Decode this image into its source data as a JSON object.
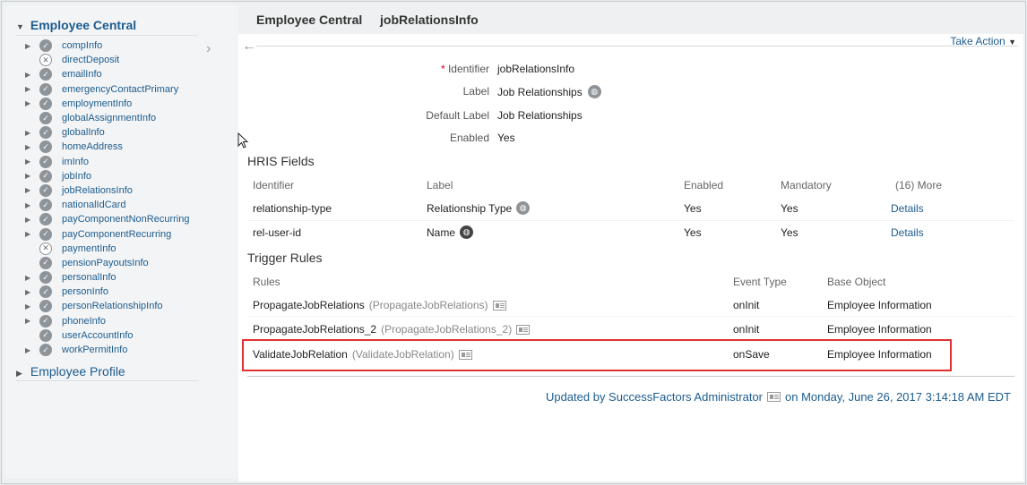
{
  "sidebar": {
    "section_title": "Employee Central",
    "section2_title": "Employee Profile",
    "items": [
      {
        "label": "compInfo",
        "status": "ok",
        "expand": true
      },
      {
        "label": "directDeposit",
        "status": "disabled",
        "expand": false
      },
      {
        "label": "emailInfo",
        "status": "ok",
        "expand": true
      },
      {
        "label": "emergencyContactPrimary",
        "status": "ok",
        "expand": true
      },
      {
        "label": "employmentInfo",
        "status": "ok",
        "expand": true
      },
      {
        "label": "globalAssignmentInfo",
        "status": "ok",
        "expand": false
      },
      {
        "label": "globalInfo",
        "status": "ok",
        "expand": true
      },
      {
        "label": "homeAddress",
        "status": "ok",
        "expand": true
      },
      {
        "label": "imInfo",
        "status": "ok",
        "expand": true
      },
      {
        "label": "jobInfo",
        "status": "ok",
        "expand": true
      },
      {
        "label": "jobRelationsInfo",
        "status": "ok",
        "expand": true
      },
      {
        "label": "nationalIdCard",
        "status": "ok",
        "expand": true
      },
      {
        "label": "payComponentNonRecurring",
        "status": "ok",
        "expand": true
      },
      {
        "label": "payComponentRecurring",
        "status": "ok",
        "expand": true
      },
      {
        "label": "paymentInfo",
        "status": "disabled",
        "expand": false
      },
      {
        "label": "pensionPayoutsInfo",
        "status": "ok",
        "expand": false
      },
      {
        "label": "personalInfo",
        "status": "ok",
        "expand": true
      },
      {
        "label": "personInfo",
        "status": "ok",
        "expand": true
      },
      {
        "label": "personRelationshipInfo",
        "status": "ok",
        "expand": true
      },
      {
        "label": "phoneInfo",
        "status": "ok",
        "expand": true
      },
      {
        "label": "userAccountInfo",
        "status": "ok",
        "expand": false
      },
      {
        "label": "workPermitInfo",
        "status": "ok",
        "expand": true
      }
    ]
  },
  "header": {
    "crumb1": "Employee Central",
    "crumb2": "jobRelationsInfo",
    "take_action": "Take Action"
  },
  "form": {
    "identifier_label": "Identifier",
    "identifier_value": "jobRelationsInfo",
    "label_label": "Label",
    "label_value": "Job Relationships",
    "default_label_label": "Default Label",
    "default_label_value": "Job Relationships",
    "enabled_label": "Enabled",
    "enabled_value": "Yes"
  },
  "hris": {
    "title": "HRIS Fields",
    "headers": {
      "identifier": "Identifier",
      "label": "Label",
      "enabled": "Enabled",
      "mandatory": "Mandatory",
      "more": "(16) More"
    },
    "rows": [
      {
        "identifier": "relationship-type",
        "label": "Relationship Type",
        "enabled": "Yes",
        "mandatory": "Yes",
        "details": "Details"
      },
      {
        "identifier": "rel-user-id",
        "label": "Name",
        "enabled": "Yes",
        "mandatory": "Yes",
        "details": "Details"
      }
    ]
  },
  "triggers": {
    "title": "Trigger Rules",
    "headers": {
      "rules": "Rules",
      "event": "Event Type",
      "base": "Base Object"
    },
    "rows": [
      {
        "name": "PropagateJobRelations",
        "id": "(PropagateJobRelations)",
        "event": "onInit",
        "base": "Employee Information"
      },
      {
        "name": "PropagateJobRelations_2",
        "id": "(PropagateJobRelations_2)",
        "event": "onInit",
        "base": "Employee Information"
      },
      {
        "name": "ValidateJobRelation",
        "id": "(ValidateJobRelation)",
        "event": "onSave",
        "base": "Employee Information"
      }
    ]
  },
  "footer": {
    "updated_by": "Updated by SuccessFactors Administrator",
    "updated_on": "on Monday, June 26, 2017 3:14:18 AM EDT"
  },
  "colors": {
    "link": "#1c5c8e",
    "highlight": "#e03030"
  }
}
